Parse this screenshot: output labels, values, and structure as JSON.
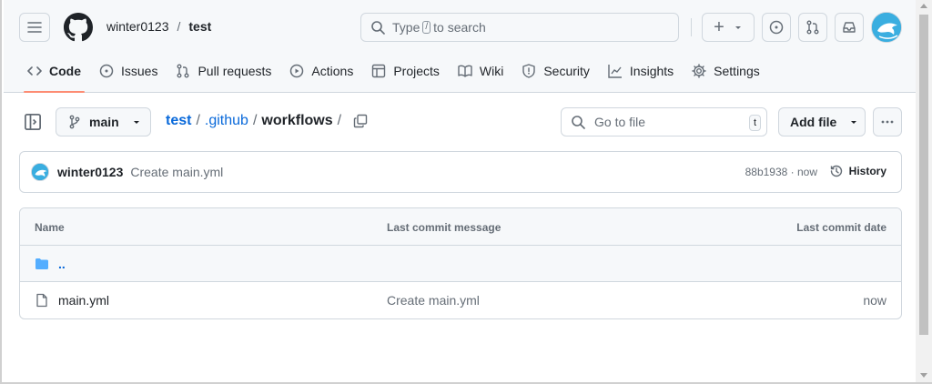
{
  "header": {
    "owner": "winter0123",
    "separator": "/",
    "repo": "test",
    "search_prefix": "Type",
    "search_key": "/",
    "search_suffix": "to search",
    "plus_label": "+"
  },
  "nav": {
    "tabs": [
      {
        "label": "Code",
        "icon": "code-icon",
        "active": true
      },
      {
        "label": "Issues",
        "icon": "issue-icon"
      },
      {
        "label": "Pull requests",
        "icon": "pull-request-icon"
      },
      {
        "label": "Actions",
        "icon": "play-icon"
      },
      {
        "label": "Projects",
        "icon": "table-icon"
      },
      {
        "label": "Wiki",
        "icon": "book-icon"
      },
      {
        "label": "Security",
        "icon": "shield-icon"
      },
      {
        "label": "Insights",
        "icon": "graph-icon"
      },
      {
        "label": "Settings",
        "icon": "gear-icon"
      }
    ]
  },
  "toolbar": {
    "branch": "main",
    "crumbs": [
      "test",
      ".github",
      "workflows"
    ],
    "crumb_sep": "/",
    "goto_placeholder": "Go to file",
    "goto_key": "t",
    "add_file": "Add file"
  },
  "commit": {
    "author": "winter0123",
    "message": "Create main.yml",
    "sha_time": "88b1938 · now",
    "history": "History"
  },
  "table": {
    "headers": [
      "Name",
      "Last commit message",
      "Last commit date"
    ],
    "parent": "..",
    "rows": [
      {
        "name": "main.yml",
        "message": "Create main.yml",
        "date": "now"
      }
    ]
  },
  "colors": {
    "accent": "#0969da",
    "tab_underline": "#fd8c73",
    "folder": "#54aeff"
  }
}
